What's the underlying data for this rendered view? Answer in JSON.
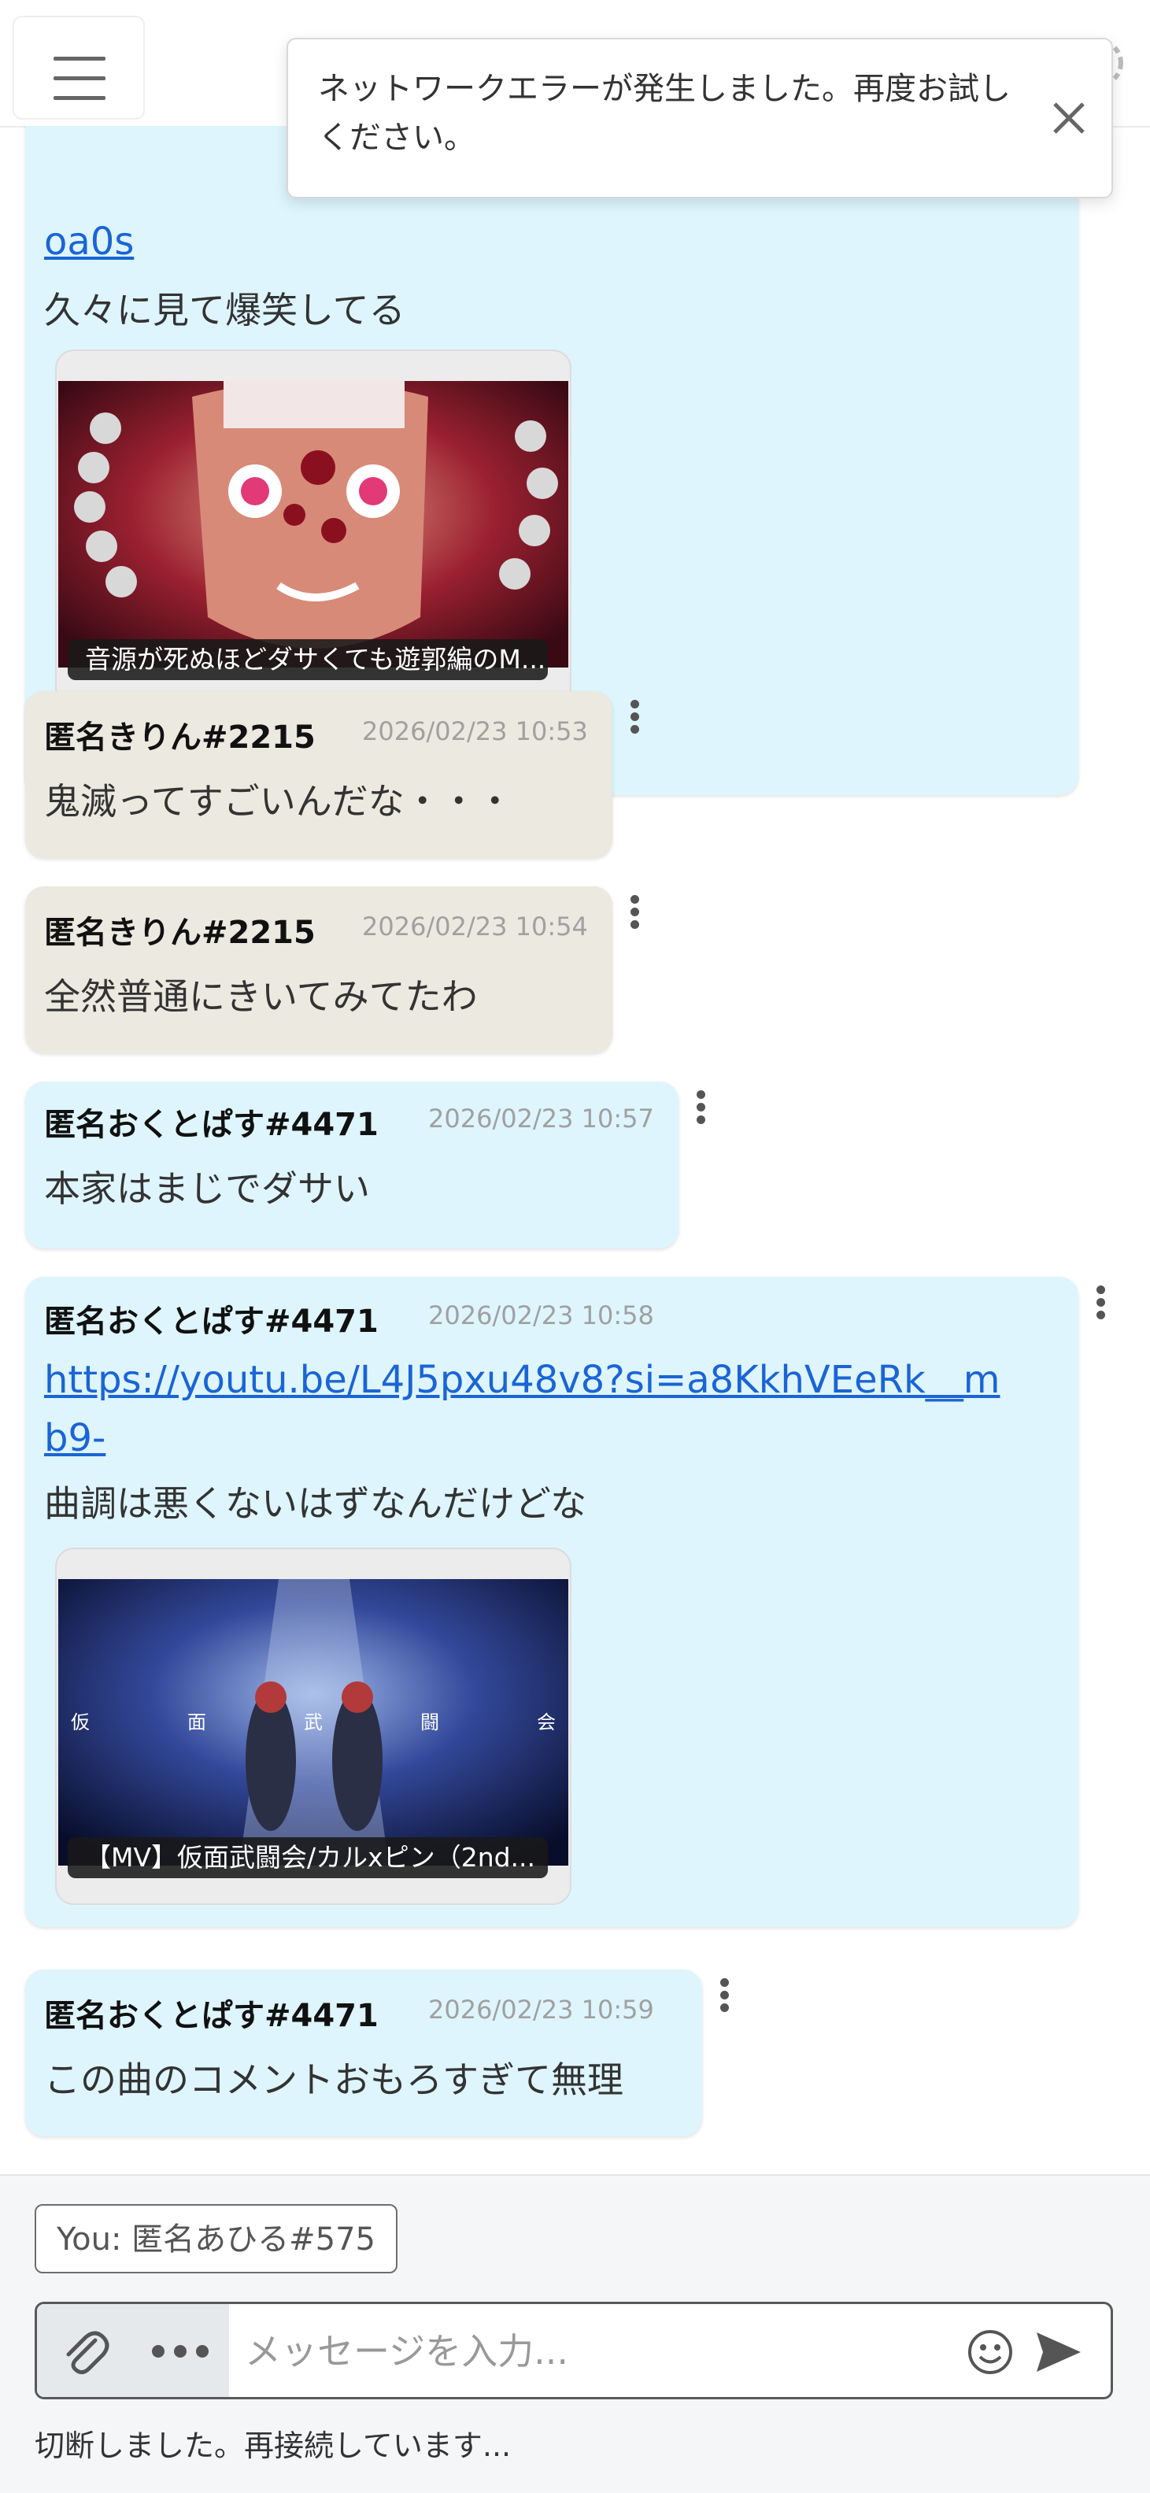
{
  "toast": {
    "message": "ネットワークエラーが発生しました。再度お試しください。"
  },
  "messages": [
    {
      "link": "oa0s",
      "text": "久々に見て爆笑してる",
      "card_caption": "音源が死ぬほどダサくても遊郭編のM..."
    },
    {
      "user": "匿名きりん#2215",
      "time": "2026/02/23 10:53",
      "text": "鬼滅ってすごいんだな・・・"
    },
    {
      "user": "匿名きりん#2215",
      "time": "2026/02/23 10:54",
      "text": "全然普通にきいてみてたわ"
    },
    {
      "user": "匿名おくとぱす#4471",
      "time": "2026/02/23 10:57",
      "text": "本家はまじでダサい"
    },
    {
      "user": "匿名おくとぱす#4471",
      "time": "2026/02/23 10:58",
      "link_line1": "https://youtu.be/L4J5pxu48v8?si=a8KkhVEeRk__m",
      "link_line2": "b9-",
      "text": "曲調は悪くないはずなんだけどな",
      "card_caption": "【MV】仮面武闘会/カルxピン（2nd...",
      "card_overlay": [
        "仮",
        "面",
        "武",
        "闘",
        "会"
      ]
    },
    {
      "user": "匿名おくとぱす#4471",
      "time": "2026/02/23 10:59",
      "text": "この曲のコメントおもろすぎて無理"
    }
  ],
  "composer": {
    "identity": "You: 匿名あひる#575",
    "placeholder": "メッセージを入力...",
    "status": "切断しました。再接続しています..."
  },
  "icons": [
    "menu-icon",
    "search-icon",
    "logo-icon",
    "user-icon",
    "gear-icon",
    "close-icon",
    "kebab-icon",
    "paperclip-icon",
    "more-icon",
    "emoji-icon",
    "send-icon"
  ],
  "colors": {
    "bubble_self": "#def5fd",
    "bubble_other": "#ebe9e0",
    "link": "#1a64d6"
  }
}
